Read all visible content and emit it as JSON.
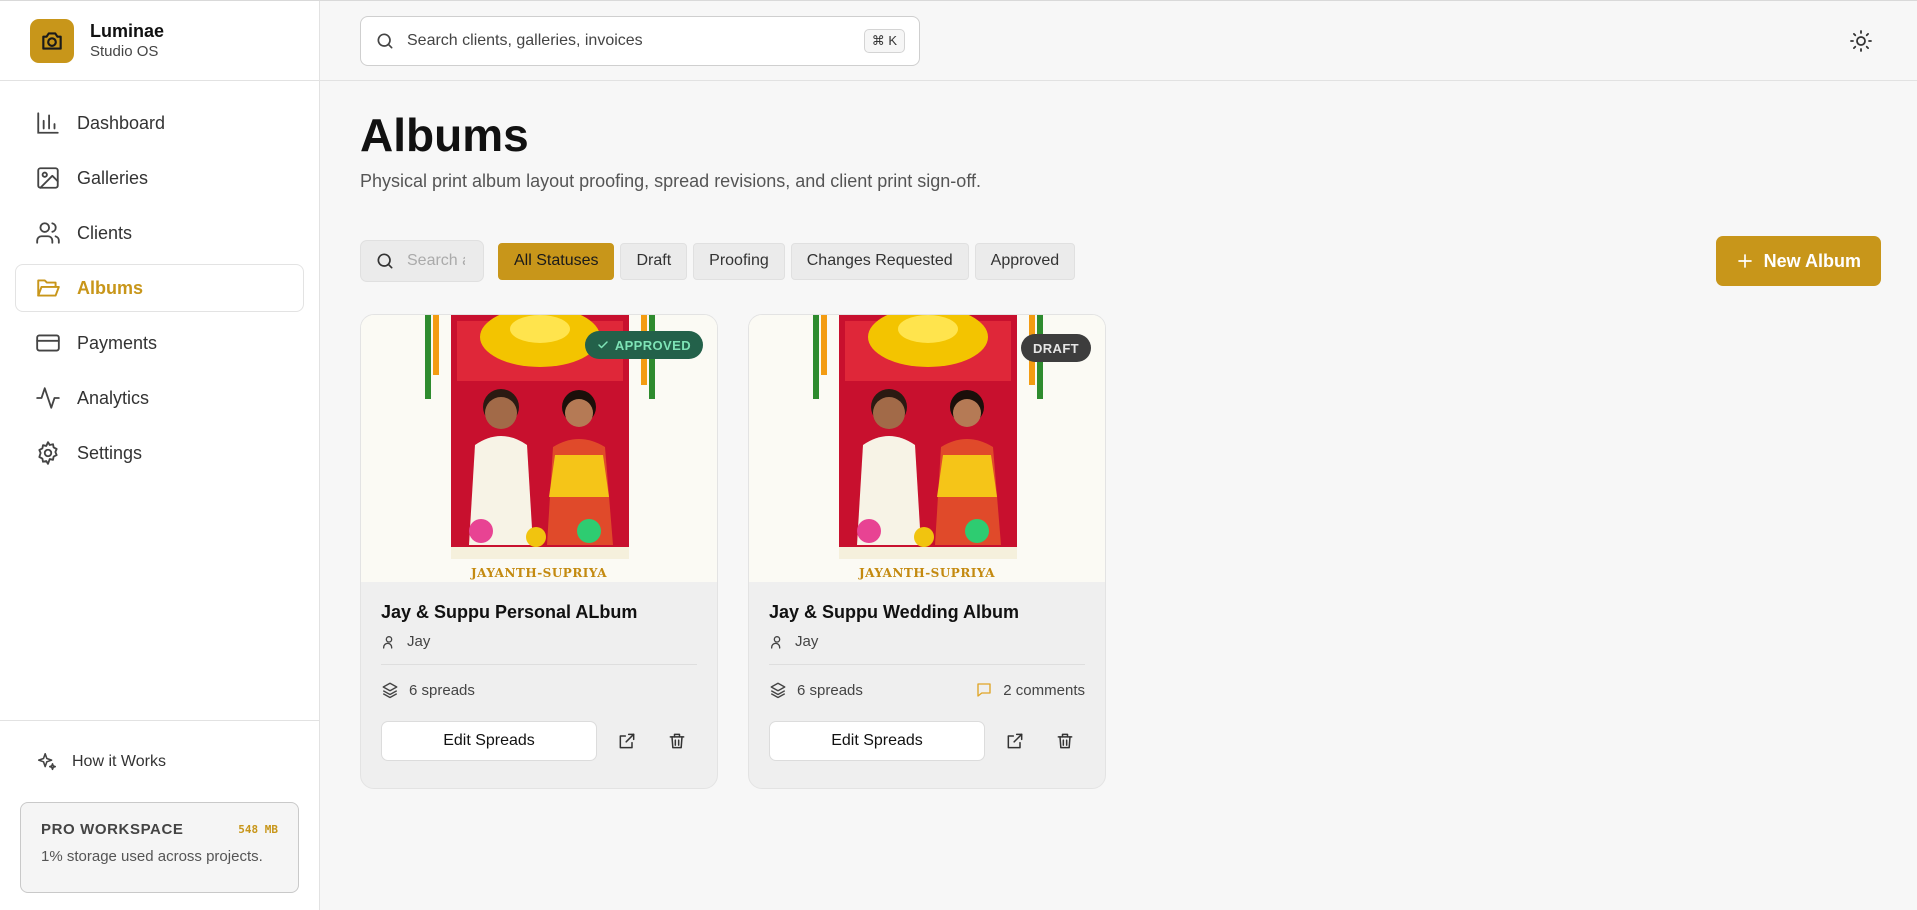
{
  "brand": {
    "name": "Luminae",
    "sub": "Studio OS",
    "logo_icon": "camera-icon",
    "accent": "#c8961a"
  },
  "sidebar": {
    "items": [
      {
        "label": "Dashboard",
        "icon": "bar-chart-icon",
        "active": false
      },
      {
        "label": "Galleries",
        "icon": "image-icon",
        "active": false
      },
      {
        "label": "Clients",
        "icon": "users-icon",
        "active": false
      },
      {
        "label": "Albums",
        "icon": "folder-open-icon",
        "active": true
      },
      {
        "label": "Payments",
        "icon": "credit-card-icon",
        "active": false
      },
      {
        "label": "Analytics",
        "icon": "activity-icon",
        "active": false
      },
      {
        "label": "Settings",
        "icon": "gear-icon",
        "active": false
      }
    ],
    "how_it_works": "How it Works",
    "workspace": {
      "title": "PRO WORKSPACE",
      "size": "548 MB",
      "desc": "1% storage used across projects."
    }
  },
  "topbar": {
    "search_placeholder": "Search clients, galleries, invoices",
    "shortcut": "⌘ K"
  },
  "page": {
    "title": "Albums",
    "subtitle": "Physical print album layout proofing, spread revisions, and client print sign-off."
  },
  "toolbar": {
    "search_placeholder": "Search albums",
    "filters": [
      {
        "label": "All Statuses",
        "active": true
      },
      {
        "label": "Draft",
        "active": false
      },
      {
        "label": "Proofing",
        "active": false
      },
      {
        "label": "Changes Requested",
        "active": false
      },
      {
        "label": "Approved",
        "active": false
      }
    ],
    "new_button": "New Album"
  },
  "albums": [
    {
      "title": "Jay & Suppu Personal ALbum",
      "client": "Jay",
      "status": "APPROVED",
      "spreads": "6 spreads",
      "comments": "",
      "caption": "JAYANTH-SUPRIYA",
      "edit_label": "Edit Spreads"
    },
    {
      "title": "Jay & Suppu Wedding Album",
      "client": "Jay",
      "status": "DRAFT",
      "spreads": "6 spreads",
      "comments": "2 comments",
      "caption": "JAYANTH-SUPRIYA",
      "edit_label": "Edit Spreads"
    }
  ]
}
